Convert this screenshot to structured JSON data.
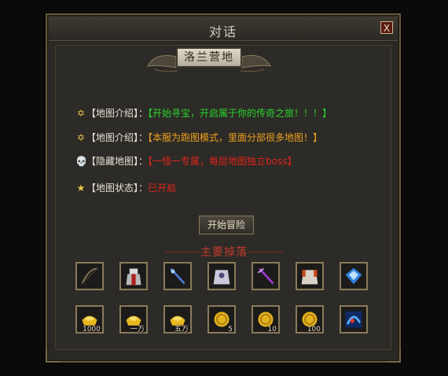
{
  "window": {
    "title": "对话",
    "close_label": "X"
  },
  "banner": {
    "label": "洛兰营地"
  },
  "info_lines": [
    {
      "icon": "star-of-david-icon",
      "icon_glyph": "✡",
      "label": "【地图介绍】：",
      "value": "【开始寻宝，开启属于你的传奇之旅！！！】",
      "color": "green"
    },
    {
      "icon": "star-of-david-icon",
      "icon_glyph": "✡",
      "label": "【地图介绍】：",
      "value": "【本服为跑图模式，里面分部很多地图！】",
      "color": "orange"
    },
    {
      "icon": "skull-icon",
      "icon_glyph": "💀",
      "label": "【隐藏地图】：",
      "value": "【一怪一专属，每层地图独立boss】",
      "color": "red"
    },
    {
      "icon": "star-icon",
      "icon_glyph": "★",
      "label": "【地图状态】：",
      "value": "已开启",
      "color": "red"
    }
  ],
  "start_button": {
    "label": "开始冒险"
  },
  "drops": {
    "title": "主要掉落",
    "row1": [
      {
        "name": "bow-icon",
        "qty": ""
      },
      {
        "name": "mage-armor-icon",
        "qty": ""
      },
      {
        "name": "blue-staff-icon",
        "qty": ""
      },
      {
        "name": "silver-armor-icon",
        "qty": ""
      },
      {
        "name": "purple-sword-icon",
        "qty": ""
      },
      {
        "name": "red-armor-icon",
        "qty": ""
      },
      {
        "name": "blue-gem-icon",
        "qty": ""
      }
    ],
    "row2": [
      {
        "name": "gold-ingot-icon",
        "qty": "1000"
      },
      {
        "name": "gold-ingot-icon",
        "qty": "一万"
      },
      {
        "name": "gold-ingot-icon",
        "qty": "五万"
      },
      {
        "name": "gold-coin-icon",
        "qty": "5"
      },
      {
        "name": "gold-coin-icon",
        "qty": "10"
      },
      {
        "name": "gold-coin-icon",
        "qty": "100"
      },
      {
        "name": "blue-scroll-icon",
        "qty": ""
      }
    ]
  }
}
